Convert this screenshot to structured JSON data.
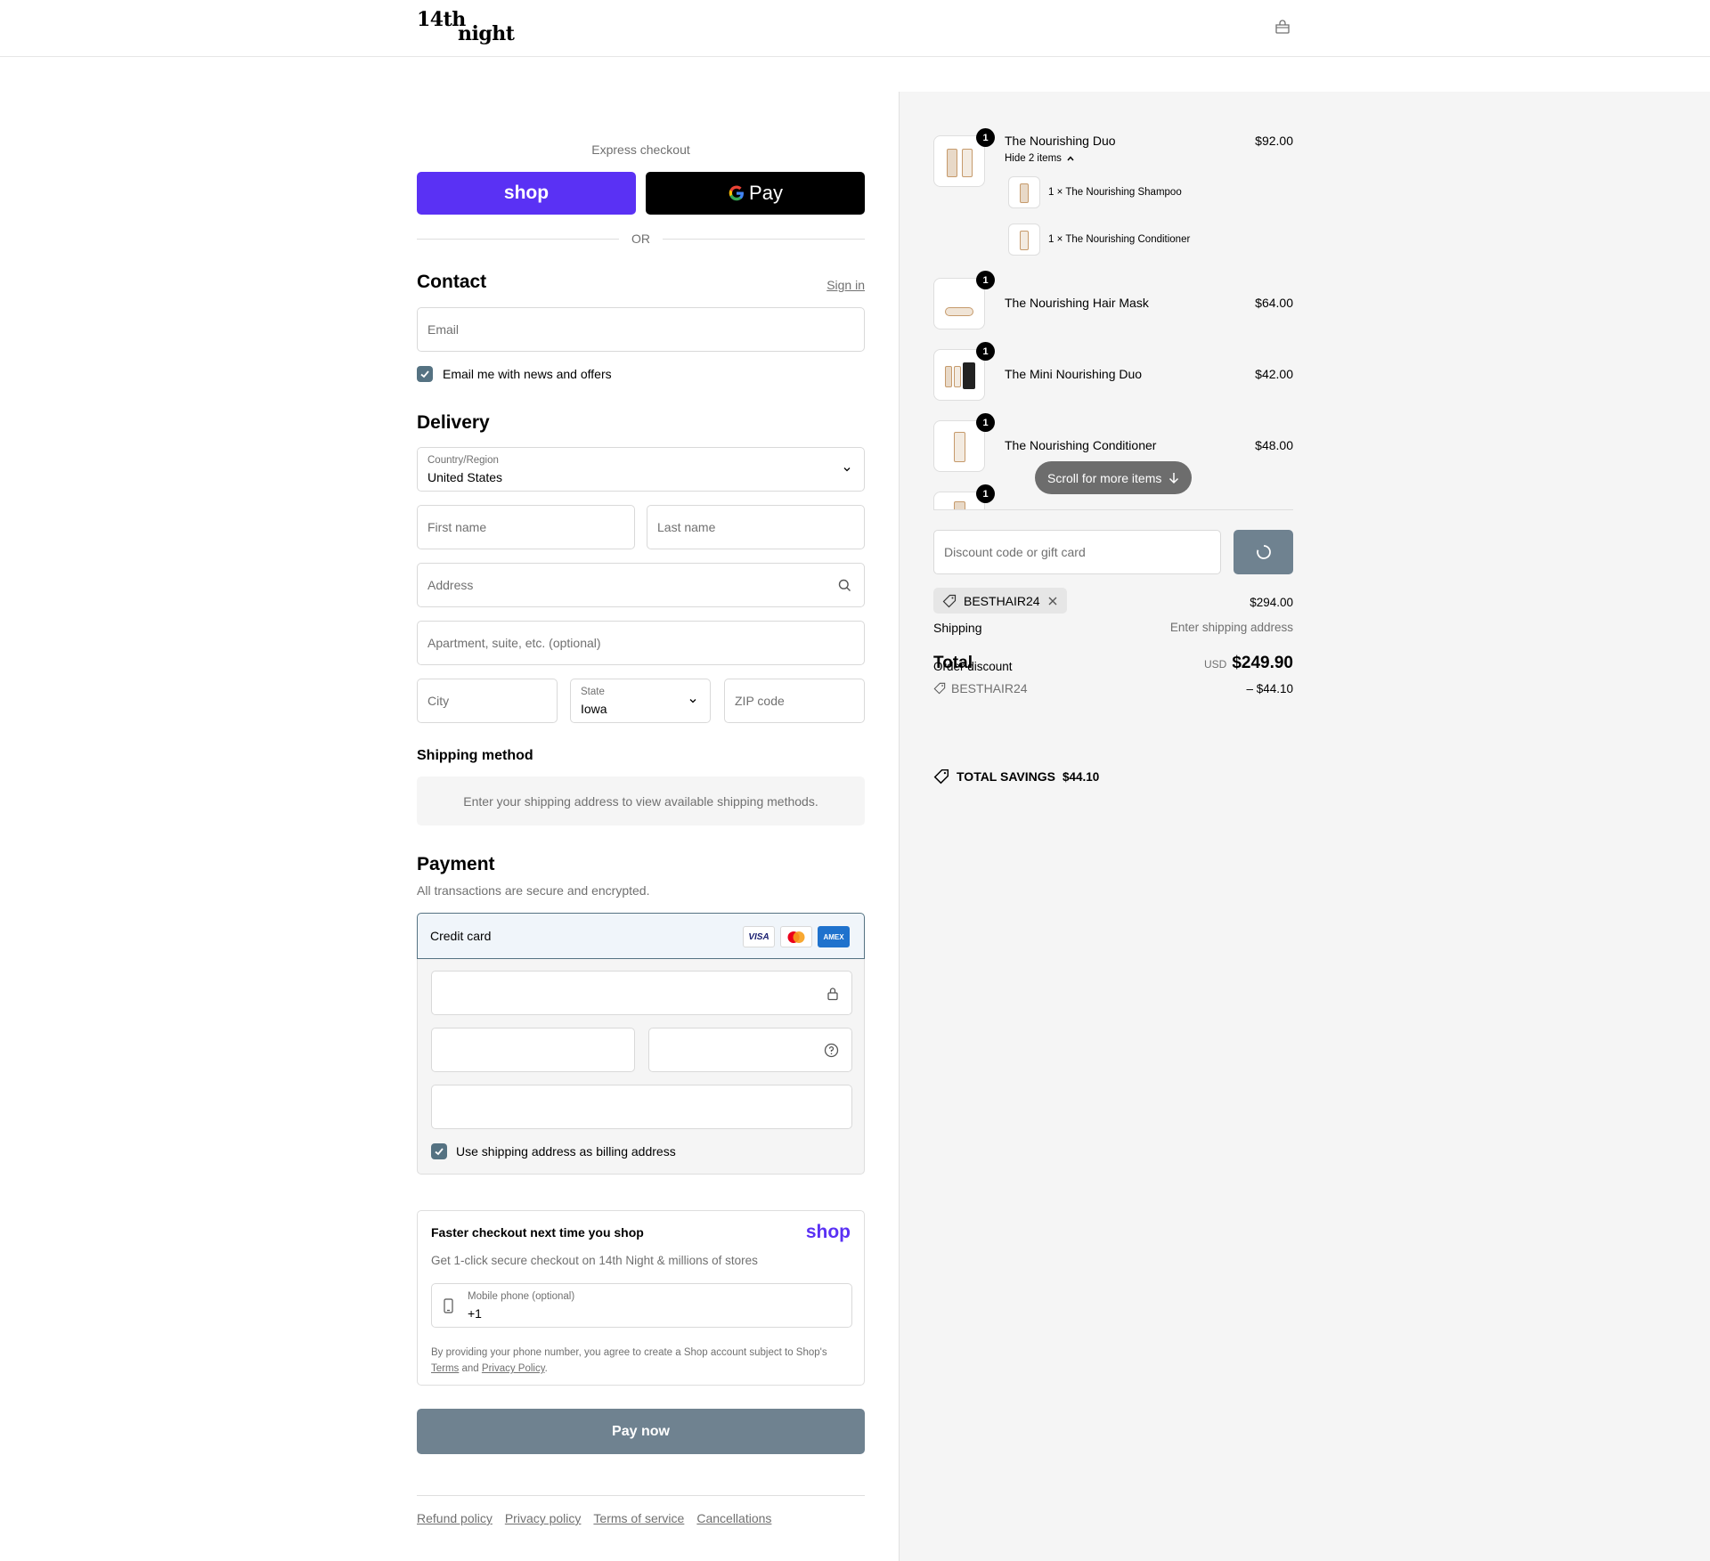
{
  "header": {
    "logo_line1": "14th",
    "logo_line2": "night"
  },
  "express": {
    "label": "Express checkout",
    "shop_label": "shop",
    "gpay_label": "Pay",
    "or_label": "OR"
  },
  "contact": {
    "title": "Contact",
    "sign_in": "Sign in",
    "email_placeholder": "Email",
    "news_label": "Email me with news and offers"
  },
  "delivery": {
    "title": "Delivery",
    "country_label": "Country/Region",
    "country_value": "United States",
    "first_name_placeholder": "First name",
    "last_name_placeholder": "Last name",
    "address_placeholder": "Address",
    "apartment_placeholder": "Apartment, suite, etc. (optional)",
    "city_placeholder": "City",
    "state_label": "State",
    "state_value": "Iowa",
    "zip_placeholder": "ZIP code"
  },
  "shipping_method": {
    "title": "Shipping method",
    "message": "Enter your shipping address to view available shipping methods."
  },
  "payment": {
    "title": "Payment",
    "subtitle": "All transactions are secure and encrypted.",
    "credit_card_label": "Credit card",
    "card_logos": [
      "VISA",
      "Mastercard",
      "AMEX"
    ],
    "billing_label": "Use shipping address as billing address"
  },
  "shop_pay": {
    "title": "Faster checkout next time you shop",
    "brand": "shop",
    "subtitle": "Get 1-click secure checkout on 14th Night & millions of stores",
    "phone_label": "Mobile phone (optional)",
    "phone_value": "+1",
    "legal_prefix": "By providing your phone number, you agree to create a Shop account subject to Shop's",
    "terms": "Terms",
    "and": "and",
    "privacy": "Privacy Policy",
    "period": "."
  },
  "pay_now": "Pay now",
  "footer_links": [
    "Refund policy",
    "Privacy policy",
    "Terms of service",
    "Cancellations"
  ],
  "order": {
    "items": [
      {
        "name": "The Nourishing Duo",
        "price": "$92.00",
        "qty": "1"
      },
      {
        "name": "The Nourishing Hair Mask",
        "price": "$64.00",
        "qty": "1"
      },
      {
        "name": "The Mini Nourishing Duo",
        "price": "$42.00",
        "qty": "1"
      },
      {
        "name": "The Nourishing Conditioner",
        "price": "$48.00",
        "qty": "1"
      },
      {
        "qty": "1"
      }
    ],
    "hide_items": "Hide 2 items",
    "sub_items": [
      {
        "qty": "1 ×",
        "name": "The Nourishing Shampoo"
      },
      {
        "qty": "1 ×",
        "name": "The Nourishing Conditioner"
      }
    ],
    "scroll_more": "Scroll for more items",
    "discount_placeholder": "Discount code or gift card",
    "discount_tag": "BESTHAIR24",
    "subtotal_value": "$294.00",
    "shipping_label": "Shipping",
    "shipping_value": "Enter shipping address",
    "total_label": "Total",
    "order_discount_label": "Order discount",
    "currency": "USD",
    "total_value": "$249.90",
    "discount_code": "BESTHAIR24",
    "discount_value": "– $44.10",
    "savings_label": "TOTAL SAVINGS",
    "savings_value": "$44.10"
  },
  "colors": {
    "shop_purple": "#5a31f4",
    "accent": "#557282",
    "pay_button": "#6f8290",
    "panel_bg": "#f5f5f5"
  }
}
